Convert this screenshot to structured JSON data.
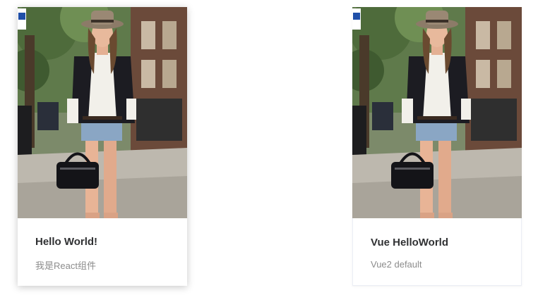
{
  "cards": [
    {
      "title": "Hello World!",
      "description": "我是React组件",
      "image_alt": "woman-street-photo"
    },
    {
      "title": "Vue HelloWorld",
      "description": "Vue2 default",
      "image_alt": "woman-street-photo"
    }
  ],
  "colors": {
    "title_text": "#303133",
    "description_text": "#8c8c8c",
    "card_background": "#ffffff"
  }
}
